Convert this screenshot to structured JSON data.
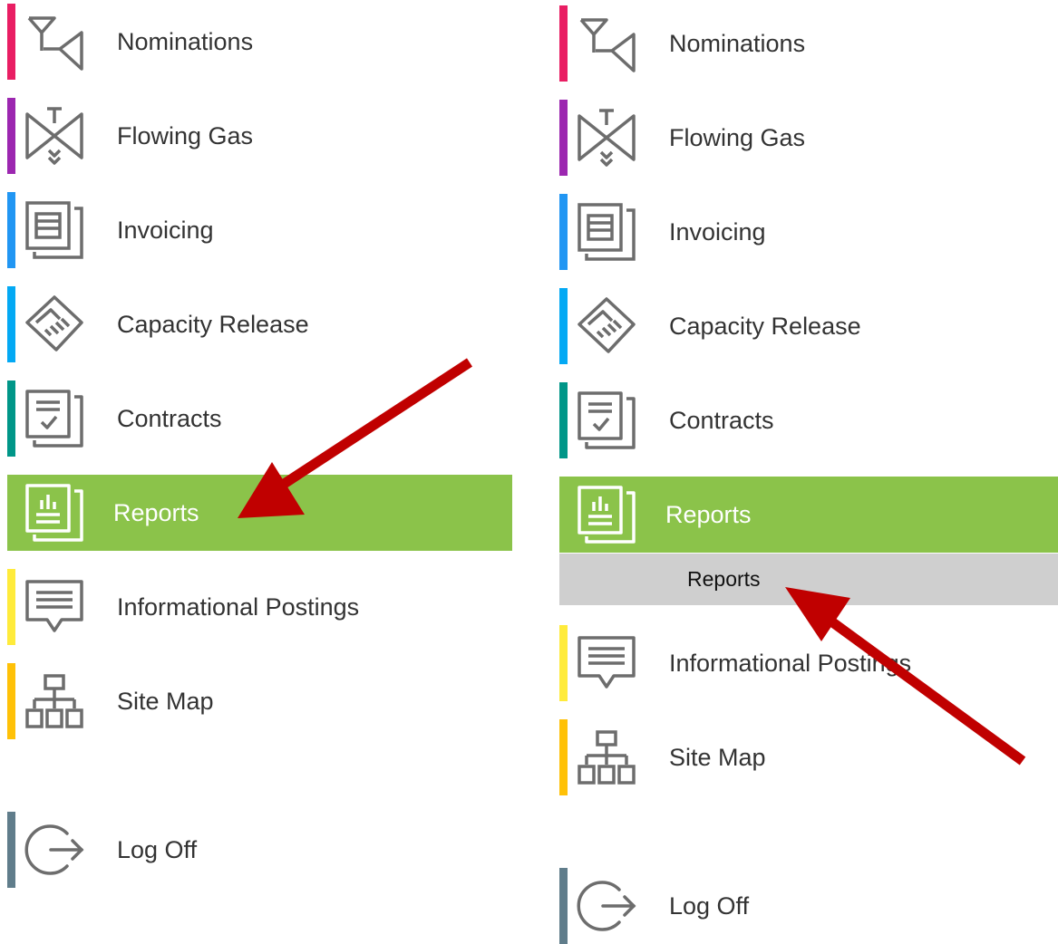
{
  "left_menu": {
    "items": [
      {
        "label": "Nominations",
        "accent": "#e91e63",
        "icon": "nominations-icon"
      },
      {
        "label": "Flowing Gas",
        "accent": "#9c27b0",
        "icon": "valve-icon"
      },
      {
        "label": "Invoicing",
        "accent": "#2196f3",
        "icon": "invoice-icon"
      },
      {
        "label": "Capacity Release",
        "accent": "#03a9f4",
        "icon": "handshake-icon"
      },
      {
        "label": "Contracts",
        "accent": "#009688",
        "icon": "contract-icon"
      },
      {
        "label": "Reports",
        "accent": "#8bc34a",
        "icon": "reports-icon",
        "active": true
      },
      {
        "label": "Informational Postings",
        "accent": "#ffeb3b",
        "icon": "postings-icon"
      },
      {
        "label": "Site Map",
        "accent": "#ffc107",
        "icon": "sitemap-icon"
      },
      {
        "label": "Log Off",
        "accent": "#607d8b",
        "icon": "logoff-icon"
      }
    ]
  },
  "right_menu": {
    "items": [
      {
        "label": "Nominations",
        "accent": "#e91e63",
        "icon": "nominations-icon"
      },
      {
        "label": "Flowing Gas",
        "accent": "#9c27b0",
        "icon": "valve-icon"
      },
      {
        "label": "Invoicing",
        "accent": "#2196f3",
        "icon": "invoice-icon"
      },
      {
        "label": "Capacity Release",
        "accent": "#03a9f4",
        "icon": "handshake-icon"
      },
      {
        "label": "Contracts",
        "accent": "#009688",
        "icon": "contract-icon"
      },
      {
        "label": "Reports",
        "accent": "#8bc34a",
        "icon": "reports-icon",
        "active": true
      },
      {
        "label": "Informational Postings",
        "accent": "#ffeb3b",
        "icon": "postings-icon"
      },
      {
        "label": "Site Map",
        "accent": "#ffc107",
        "icon": "sitemap-icon"
      },
      {
        "label": "Log Off",
        "accent": "#607d8b",
        "icon": "logoff-icon"
      }
    ],
    "submenu": {
      "label": "Reports"
    }
  },
  "colors": {
    "active_bg": "#8bc34a",
    "submenu_bg": "#cfcfcf",
    "icon_gray": "#6d6d6d",
    "annotation_arrow": "#c00000"
  }
}
